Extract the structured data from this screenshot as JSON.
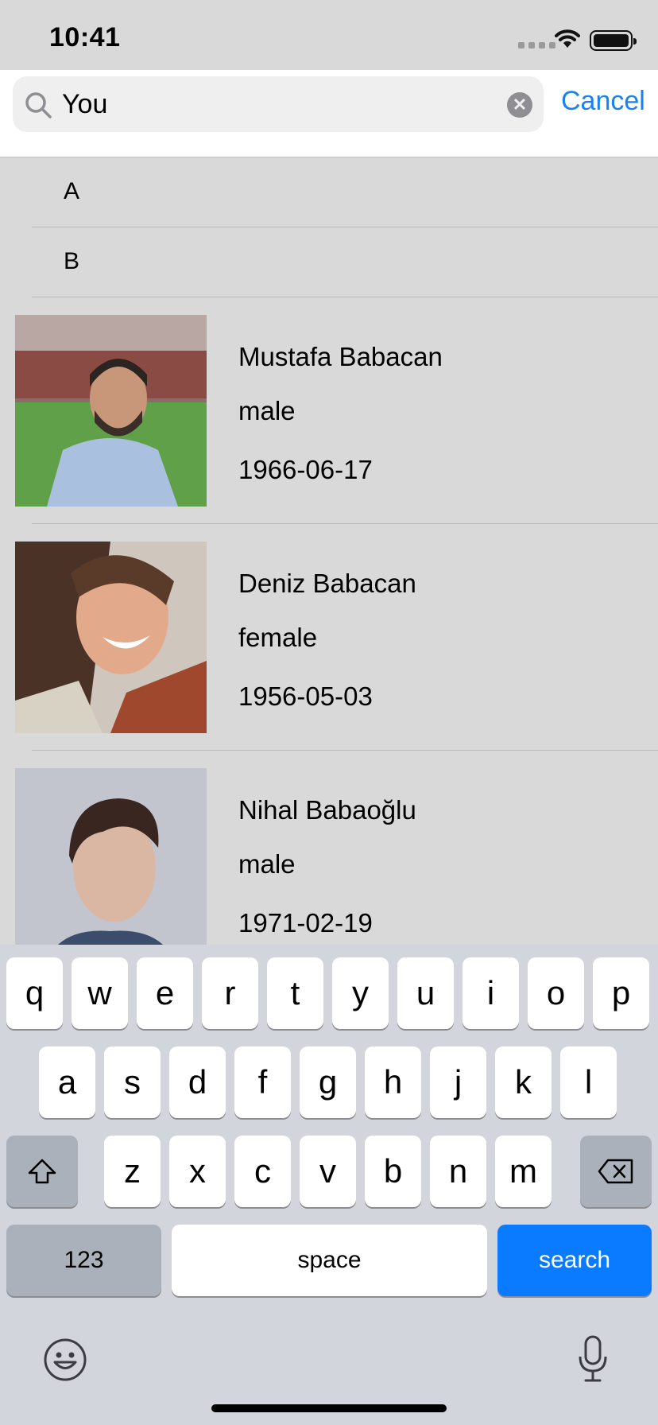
{
  "status_bar": {
    "time": "10:41"
  },
  "search": {
    "query": "You",
    "cancel_label": "Cancel"
  },
  "sections": [
    {
      "letter": "A"
    },
    {
      "letter": "B"
    }
  ],
  "people": [
    {
      "name": "Mustafa Babacan",
      "gender": "male",
      "dob": "1966-06-17"
    },
    {
      "name": "Deniz Babacan",
      "gender": "female",
      "dob": "1956-05-03"
    },
    {
      "name": "Nihal Babaoğlu",
      "gender": "male",
      "dob": "1971-02-19"
    }
  ],
  "keyboard": {
    "row1": [
      "q",
      "w",
      "e",
      "r",
      "t",
      "y",
      "u",
      "i",
      "o",
      "p"
    ],
    "row2": [
      "a",
      "s",
      "d",
      "f",
      "g",
      "h",
      "j",
      "k",
      "l"
    ],
    "row3": [
      "z",
      "x",
      "c",
      "v",
      "b",
      "n",
      "m"
    ],
    "numbers_label": "123",
    "space_label": "space",
    "return_label": "search",
    "shift_icon": "shift-icon",
    "backspace_icon": "backspace-icon",
    "emoji_icon": "emoji-icon",
    "mic_icon": "microphone-icon"
  },
  "colors": {
    "accent": "#1a82f0",
    "search_key": "#0a7bff",
    "list_background": "#d9d9d9",
    "keyboard_background": "#d2d5dc"
  }
}
